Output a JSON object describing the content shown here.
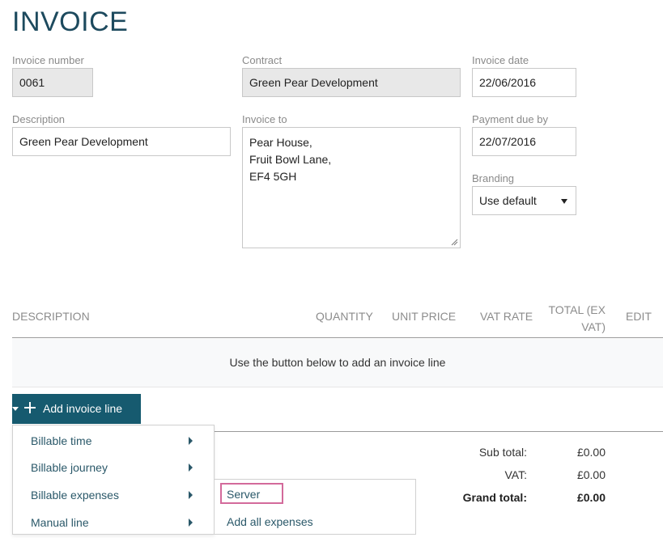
{
  "page": {
    "title": "INVOICE"
  },
  "fields": {
    "invoice_number": {
      "label": "Invoice number",
      "value": "0061"
    },
    "contract": {
      "label": "Contract",
      "value": "Green Pear Development"
    },
    "invoice_date": {
      "label": "Invoice date",
      "value": "22/06/2016"
    },
    "description": {
      "label": "Description",
      "value": "Green Pear Development"
    },
    "invoice_to": {
      "label": "Invoice to",
      "lines": [
        "Pear House,",
        "Fruit Bowl Lane,",
        "EF4 5GH"
      ]
    },
    "payment_due_by": {
      "label": "Payment due by",
      "value": "22/07/2016"
    },
    "branding": {
      "label": "Branding",
      "value": "Use default"
    }
  },
  "table": {
    "headers": {
      "description": "DESCRIPTION",
      "quantity": "QUANTITY",
      "unit_price": "UNIT PRICE",
      "vat_rate": "VAT RATE",
      "total_line1": "TOTAL (EX",
      "total_line2": "VAT)",
      "edit": "EDIT"
    },
    "empty_message": "Use the button below to add an invoice line"
  },
  "add_button": {
    "label": "Add invoice line",
    "icon": "plus-icon"
  },
  "menu": {
    "items": [
      {
        "label": "Billable time"
      },
      {
        "label": "Billable journey"
      },
      {
        "label": "Billable expenses"
      },
      {
        "label": "Manual line"
      }
    ]
  },
  "submenu": {
    "items": [
      {
        "label": "Server"
      },
      {
        "label": "Add all expenses"
      }
    ]
  },
  "totals": {
    "sub_total_label": "Sub total:",
    "sub_total_value": "£0.00",
    "vat_label": "VAT:",
    "vat_value": "£0.00",
    "grand_total_label": "Grand total:",
    "grand_total_value": "£0.00"
  },
  "colors": {
    "title": "#1d4a5e",
    "button": "#165a6f",
    "menu_text": "#2a5869",
    "highlight_border": "#d36a9b"
  }
}
